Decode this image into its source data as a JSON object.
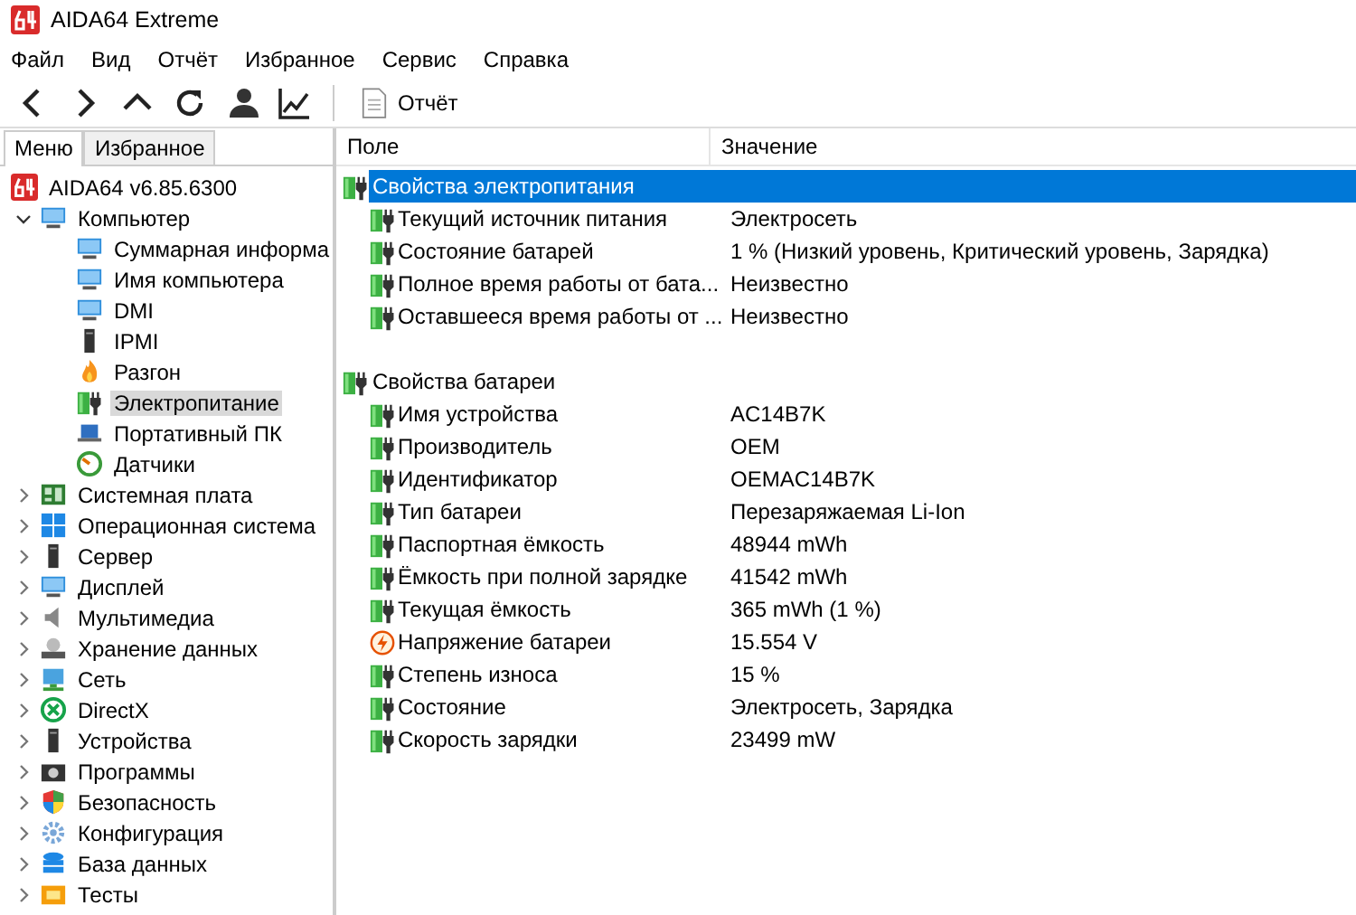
{
  "window": {
    "title": "AIDA64 Extreme"
  },
  "menu": [
    "Файл",
    "Вид",
    "Отчёт",
    "Избранное",
    "Сервис",
    "Справка"
  ],
  "toolbar": {
    "report_button": "Отчёт"
  },
  "sidebar_tabs": [
    {
      "label": "Меню",
      "selected": true
    },
    {
      "label": "Избранное",
      "selected": false
    }
  ],
  "tree": {
    "label": "AIDA64 v6.85.6300",
    "children": [
      {
        "label": "Компьютер",
        "expanded": true,
        "selected": false,
        "children": [
          {
            "label": "Суммарная информа",
            "selected": false
          },
          {
            "label": "Имя компьютера",
            "selected": false
          },
          {
            "label": "DMI",
            "selected": false
          },
          {
            "label": "IPMI",
            "selected": false
          },
          {
            "label": "Разгон",
            "selected": false
          },
          {
            "label": "Электропитание",
            "selected": true
          },
          {
            "label": "Портативный ПК",
            "selected": false
          },
          {
            "label": "Датчики",
            "selected": false
          }
        ]
      },
      {
        "label": "Системная плата",
        "expanded": false,
        "selected": false
      },
      {
        "label": "Операционная система",
        "expanded": false,
        "selected": false
      },
      {
        "label": "Сервер",
        "expanded": false,
        "selected": false
      },
      {
        "label": "Дисплей",
        "expanded": false,
        "selected": false
      },
      {
        "label": "Мультимедиа",
        "expanded": false,
        "selected": false
      },
      {
        "label": "Хранение данных",
        "expanded": false,
        "selected": false
      },
      {
        "label": "Сеть",
        "expanded": false,
        "selected": false
      },
      {
        "label": "DirectX",
        "expanded": false,
        "selected": false
      },
      {
        "label": "Устройства",
        "expanded": false,
        "selected": false
      },
      {
        "label": "Программы",
        "expanded": false,
        "selected": false
      },
      {
        "label": "Безопасность",
        "expanded": false,
        "selected": false
      },
      {
        "label": "Конфигурация",
        "expanded": false,
        "selected": false
      },
      {
        "label": "База данных",
        "expanded": false,
        "selected": false
      },
      {
        "label": "Тесты",
        "expanded": false,
        "selected": false
      }
    ]
  },
  "table": {
    "columns": [
      "Поле",
      "Значение"
    ],
    "groups": [
      {
        "title": "Свойства электропитания",
        "selected": true,
        "rows": [
          {
            "kind": "battery",
            "field": "Текущий источник питания",
            "value": "Электросеть"
          },
          {
            "kind": "battery",
            "field": "Состояние батарей",
            "value": "1 % (Низкий уровень, Критический уровень, Зарядка)"
          },
          {
            "kind": "battery",
            "field": "Полное время работы от бата...",
            "value": "Неизвестно"
          },
          {
            "kind": "battery",
            "field": "Оставшееся время работы от ...",
            "value": "Неизвестно"
          }
        ]
      },
      {
        "title": "Свойства батареи",
        "selected": false,
        "rows": [
          {
            "kind": "battery",
            "field": "Имя устройства",
            "value": "AC14B7K"
          },
          {
            "kind": "battery",
            "field": "Производитель",
            "value": "OEM"
          },
          {
            "kind": "battery",
            "field": "Идентификатор",
            "value": "OEMAC14B7K"
          },
          {
            "kind": "battery",
            "field": "Тип батареи",
            "value": "Перезаряжаемая Li-Ion"
          },
          {
            "kind": "battery",
            "field": "Паспортная ёмкость",
            "value": "48944 mWh"
          },
          {
            "kind": "battery",
            "field": "Ёмкость при полной зарядке",
            "value": "41542 mWh"
          },
          {
            "kind": "battery",
            "field": "Текущая ёмкость",
            "value": "365 mWh  (1 %)"
          },
          {
            "kind": "voltage",
            "field": "Напряжение батареи",
            "value": "15.554 V"
          },
          {
            "kind": "battery",
            "field": "Степень износа",
            "value": "15 %"
          },
          {
            "kind": "battery",
            "field": "Состояние",
            "value": "Электросеть, Зарядка"
          },
          {
            "kind": "battery",
            "field": "Скорость зарядки",
            "value": "23499 mW"
          }
        ]
      }
    ]
  }
}
